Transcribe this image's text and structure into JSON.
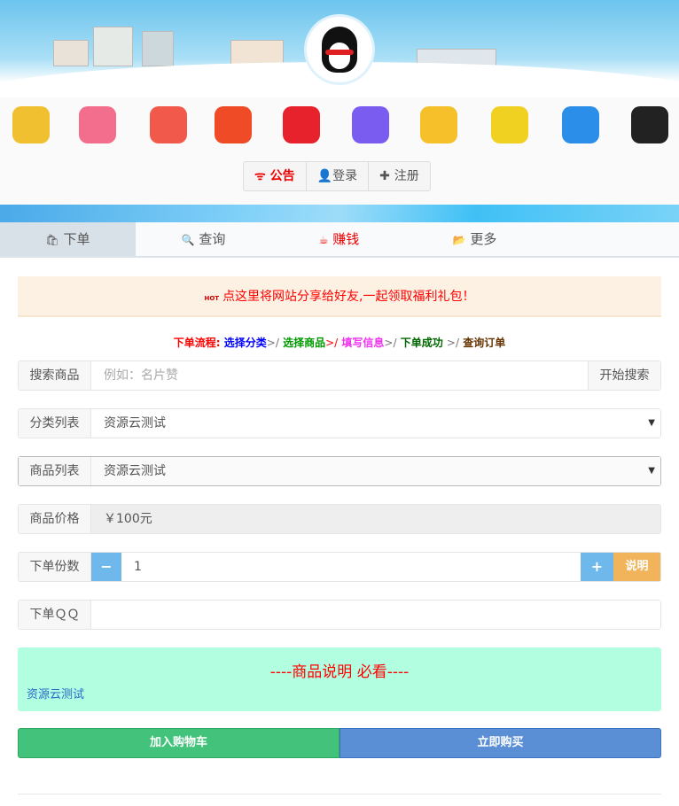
{
  "header": {
    "announce": "公告",
    "login": "登录",
    "register": "注册"
  },
  "apps": [
    {
      "name": "singing-app-icon",
      "color": "#f0c030"
    },
    {
      "name": "bilibili-icon",
      "color": "#f36d8d"
    },
    {
      "name": "music-app-icon",
      "color": "#f15a4a"
    },
    {
      "name": "listen-app-icon",
      "color": "#ef4b26"
    },
    {
      "name": "video-play-icon",
      "color": "#e8222c"
    },
    {
      "name": "video-app-icon",
      "color": "#7a5cf0"
    },
    {
      "name": "qq-penguin-icon",
      "color": "#f5c02a"
    },
    {
      "name": "cartoon-face-icon",
      "color": "#f0d020"
    },
    {
      "name": "qzone-star-icon",
      "color": "#2b8ee8"
    },
    {
      "name": "qq-icon",
      "color": "#222222"
    }
  ],
  "tabs": [
    {
      "label": "下单",
      "icon": "🛍"
    },
    {
      "label": "查询",
      "icon": "🔍"
    },
    {
      "label": "赚钱",
      "icon": "☕"
    },
    {
      "label": "更多",
      "icon": "📂"
    }
  ],
  "notice": {
    "hot": "HOT",
    "text": "点这里将网站分享给好友,一起领取福利礼包！"
  },
  "flow": {
    "title": "下单流程:",
    "s1": "选择分类",
    "s2": "选择商品",
    "s3": "填写信息",
    "s4": "下单成功",
    "s5": "查询订单",
    "sep": ">/"
  },
  "form": {
    "search_label": "搜索商品",
    "search_placeholder": "例如：名片赞",
    "search_button": "开始搜索",
    "category_label": "分类列表",
    "category_value": "资源云测试",
    "product_label": "商品列表",
    "product_value": "资源云测试",
    "price_label": "商品价格",
    "price_value": "￥100元",
    "qty_label": "下单份数",
    "qty_value": "1",
    "minus": "−",
    "plus": "+",
    "explain": "说明",
    "qq_label": "下单ＱＱ",
    "qq_value": ""
  },
  "desc": {
    "title": "----商品说明 必看----",
    "text": "资源云测试"
  },
  "actions": {
    "cart": "加入购物车",
    "buy": "立即购买"
  },
  "colors": {
    "green": "#42c27a",
    "blue": "#5b8fd5",
    "red": "#ff0000"
  }
}
